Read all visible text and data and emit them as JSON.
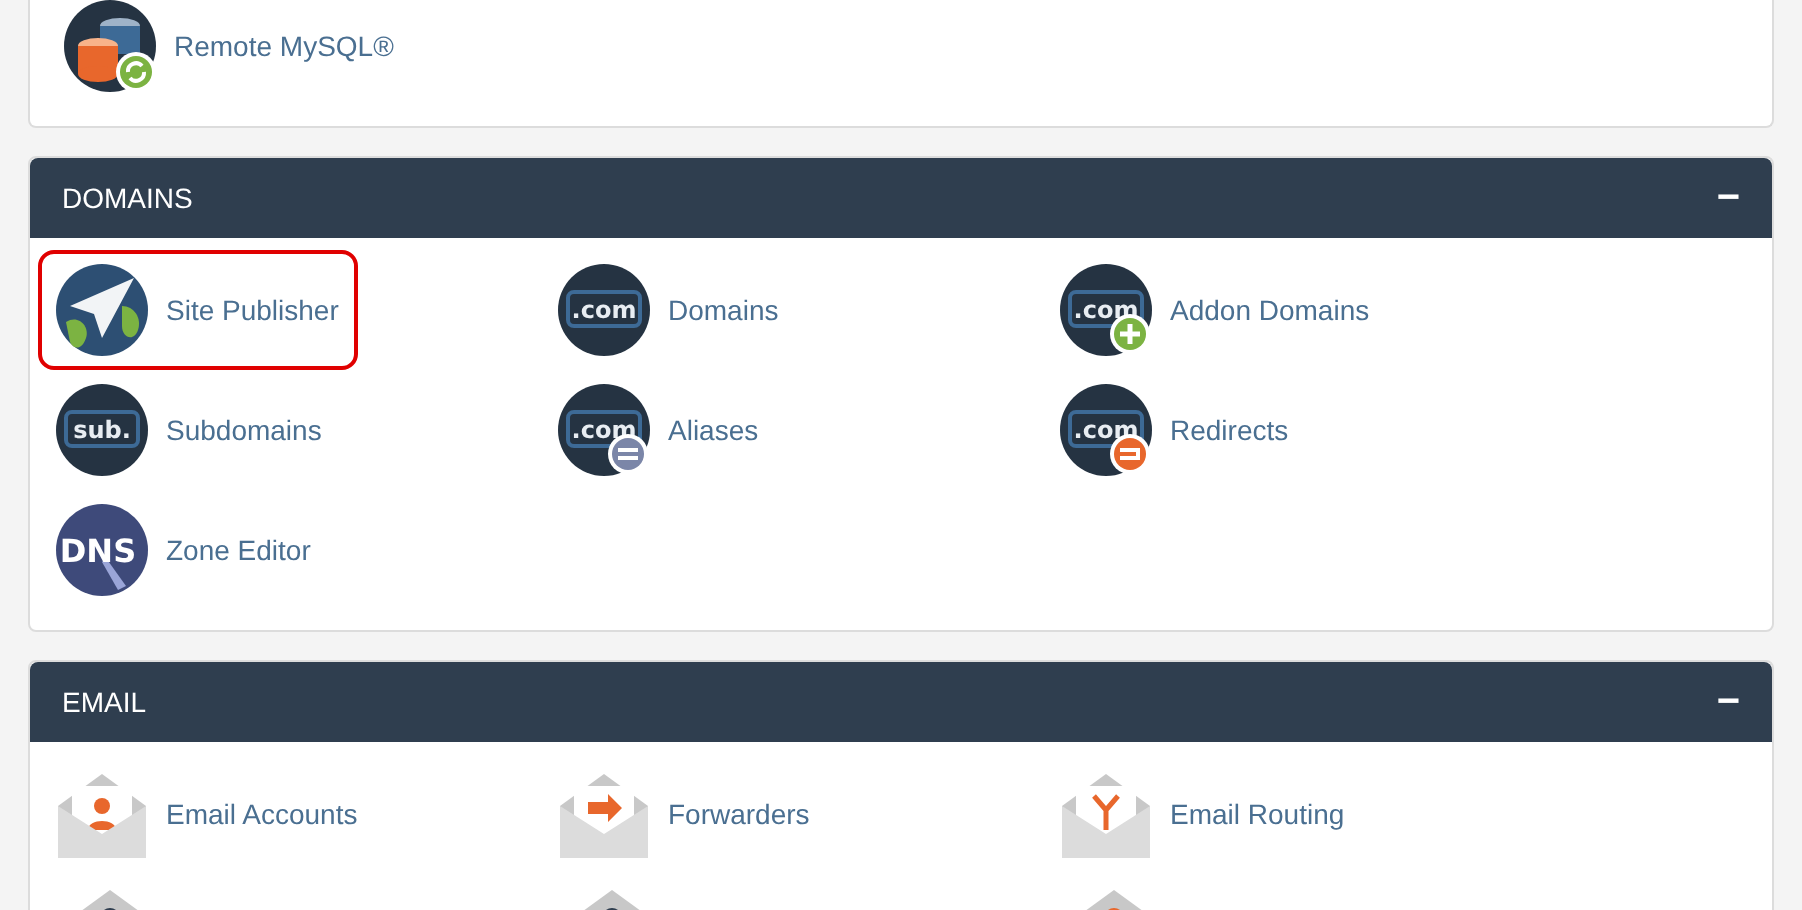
{
  "top_panel": {
    "items": [
      {
        "label": "Remote MySQL®"
      }
    ]
  },
  "sections": [
    {
      "title": "DOMAINS",
      "collapse_symbol": "−",
      "expanded": true,
      "items": [
        {
          "label": "Site Publisher",
          "highlighted": true
        },
        {
          "label": "Domains",
          "highlighted": false,
          "icon_text": ".com"
        },
        {
          "label": "Addon Domains",
          "highlighted": false,
          "icon_text": ".com"
        },
        {
          "label": "Subdomains",
          "highlighted": false,
          "icon_text": "sub."
        },
        {
          "label": "Aliases",
          "highlighted": false,
          "icon_text": ".com"
        },
        {
          "label": "Redirects",
          "highlighted": false,
          "icon_text": ".com"
        },
        {
          "label": "Zone Editor",
          "highlighted": false,
          "icon_text": "DNS"
        }
      ]
    },
    {
      "title": "EMAIL",
      "collapse_symbol": "−",
      "expanded": true,
      "items": [
        {
          "label": "Email Accounts",
          "highlighted": false
        },
        {
          "label": "Forwarders",
          "highlighted": false
        },
        {
          "label": "Email Routing",
          "highlighted": false
        }
      ]
    }
  ]
}
